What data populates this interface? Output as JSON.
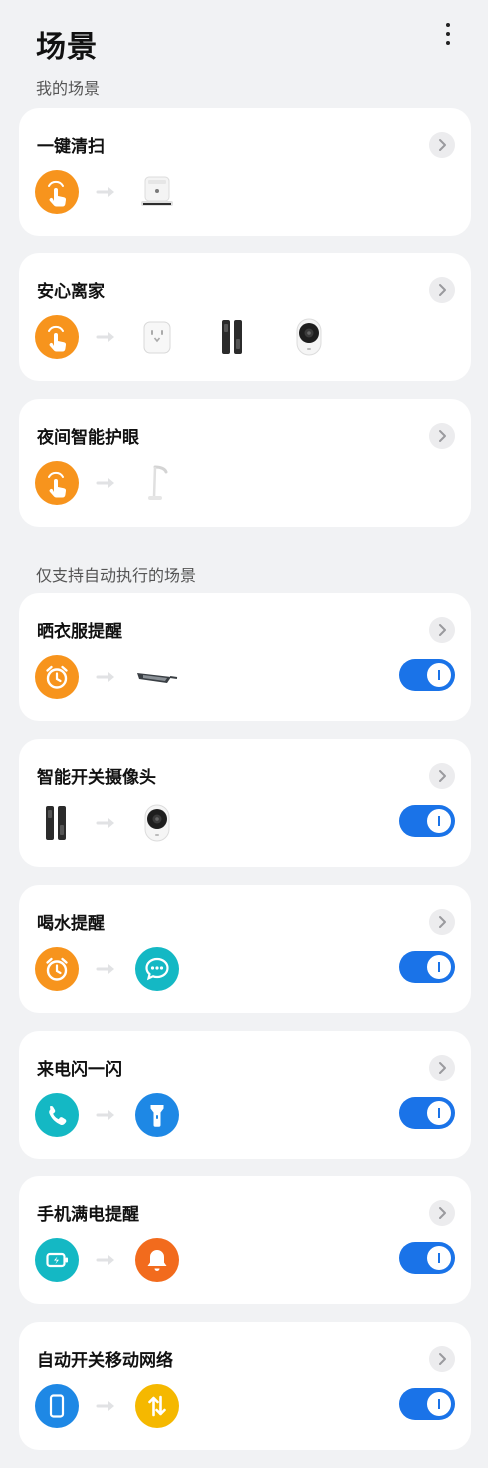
{
  "header": {
    "title": "场景",
    "subtitle": "我的场景",
    "more_icon": "more-vertical-icon"
  },
  "section2_label": "仅支持自动执行的场景",
  "colors": {
    "accent_blue": "#1a73e8",
    "orange": "#f7941d",
    "teal": "#14b8c4",
    "blue": "#1e88e5",
    "red_orange": "#f26b1d",
    "yellow": "#f5b800"
  },
  "my_scenes": [
    {
      "title": "一键清扫",
      "trigger_icon": "tap-hand-icon",
      "devices": [
        "robot-vacuum-icon"
      ]
    },
    {
      "title": "安心离家",
      "trigger_icon": "tap-hand-icon",
      "devices": [
        "smart-plug-icon",
        "door-lock-icon",
        "camera-icon"
      ]
    },
    {
      "title": "夜间智能护眼",
      "trigger_icon": "tap-hand-icon",
      "devices": [
        "desk-lamp-icon"
      ]
    }
  ],
  "auto_scenes": [
    {
      "title": "晒衣服提醒",
      "trigger_icon": "alarm-clock-icon",
      "target_icon": "clothes-rack-icon",
      "enabled": true
    },
    {
      "title": "智能开关摄像头",
      "trigger_icon": "door-lock-icon",
      "target_icon": "camera-icon",
      "enabled": true
    },
    {
      "title": "喝水提醒",
      "trigger_icon": "alarm-clock-icon",
      "target_icon": "message-icon",
      "enabled": true
    },
    {
      "title": "来电闪一闪",
      "trigger_icon": "phone-icon",
      "target_icon": "flashlight-icon",
      "enabled": true
    },
    {
      "title": "手机满电提醒",
      "trigger_icon": "battery-icon",
      "target_icon": "bell-icon",
      "enabled": true
    },
    {
      "title": "自动开关移动网络",
      "trigger_icon": "smartphone-icon",
      "target_icon": "mobile-data-icon",
      "enabled": true
    }
  ]
}
